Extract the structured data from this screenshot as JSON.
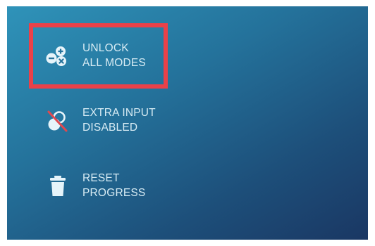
{
  "menu": {
    "items": [
      {
        "id": "unlock",
        "line1": "UNLOCK",
        "line2": "ALL MODES",
        "icon": "unlock-modes-icon"
      },
      {
        "id": "extra",
        "line1": "EXTRA INPUT",
        "line2": "DISABLED",
        "icon": "extra-input-disabled-icon"
      },
      {
        "id": "reset",
        "line1": "RESET",
        "line2": "PROGRESS",
        "icon": "trash-icon"
      }
    ]
  },
  "colors": {
    "accent_highlight": "#ea4149",
    "text": "#d8ecf4",
    "icon": "#e6f4fa",
    "strike": "#e0484f",
    "background_top": "#2f93b9",
    "background_bottom": "#1a3763"
  }
}
